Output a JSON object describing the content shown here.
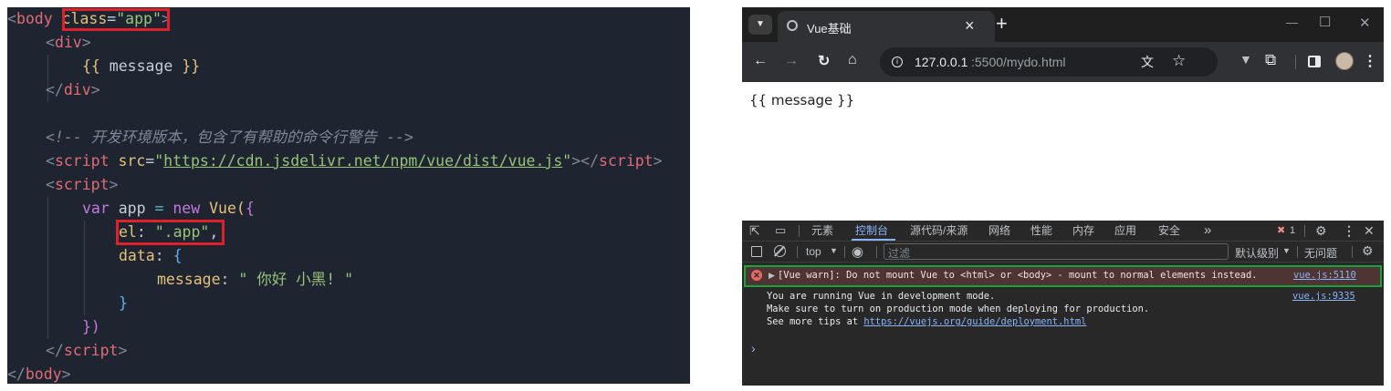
{
  "editor": {
    "lines": {
      "l1": {
        "open": "<",
        "tag": "body",
        "attr": "class",
        "eq": "=",
        "val": "\"app\"",
        "close": ">"
      },
      "l2": {
        "open": "<",
        "tag": "div",
        "close": ">"
      },
      "l3": {
        "lb": "{{",
        "text": " message ",
        "rb": "}}"
      },
      "l4": {
        "open": "</",
        "tag": "div",
        "close": ">"
      },
      "l6": {
        "comment": "<!-- 开发环境版本，包含了有帮助的命令行警告 -->"
      },
      "l7": {
        "open": "<",
        "tag": "script",
        "attr": "src",
        "eq": "=",
        "q1": "\"",
        "url": "https://cdn.jsdelivr.net/npm/vue/dist/vue.js",
        "q2": "\"",
        "close": ">",
        "open2": "</",
        "tag2": "script",
        "close2": ">"
      },
      "l8": {
        "open": "<",
        "tag": "script",
        "close": ">"
      },
      "l9": {
        "kw": "var",
        "name": " app ",
        "op": "=",
        "kw2": " new ",
        "fn": "Vue",
        "p": "(",
        "b": "{"
      },
      "l10": {
        "key": "el",
        "colon": ": ",
        "val": "\".app\"",
        "comma": ","
      },
      "l11": {
        "key": "data",
        "colon": ": ",
        "b": "{"
      },
      "l12": {
        "key": "message",
        "colon": ": ",
        "val": "\" 你好 小黑! \""
      },
      "l13": {
        "b": "}"
      },
      "l14": {
        "b": "})"
      },
      "l15": {
        "open": "</",
        "tag": "script",
        "close": ">"
      },
      "l16": {
        "open": "</",
        "tag": "body",
        "close": ">"
      }
    }
  },
  "browser": {
    "tab": {
      "title": "Vue基础",
      "close": "×"
    },
    "new_tab": "+",
    "window": {
      "minimize": "—",
      "maximize": "☐",
      "close": "✕"
    },
    "address": {
      "host": "127.0.0.1",
      "rest": ":5500/mydo.html"
    },
    "page_text": "{{ message }}",
    "devtools": {
      "tabs": [
        "元素",
        "控制台",
        "源代码/来源",
        "网络",
        "性能",
        "内存",
        "应用",
        "安全"
      ],
      "more": "»",
      "error_count": "1",
      "filter": {
        "context": "top",
        "placeholder": "过滤",
        "level": "默认级别",
        "issues": "无问题"
      },
      "messages": {
        "error": {
          "text": "[Vue warn]: Do not mount Vue to <html> or <body> - mount to normal elements instead.",
          "source": "vue.js:5110"
        },
        "info": {
          "line1": "You are running Vue in development mode.",
          "line2": "Make sure to turn on production mode when deploying for production.",
          "line3_prefix": "See more tips at ",
          "line3_link": "https://vuejs.org/guide/deployment.html",
          "source": "vue.js:9335"
        },
        "prompt": "›"
      }
    }
  },
  "colors": {
    "error_red": "#e0202a",
    "highlight_green": "#1aa33a",
    "accent_blue": "#8ab4f8"
  }
}
